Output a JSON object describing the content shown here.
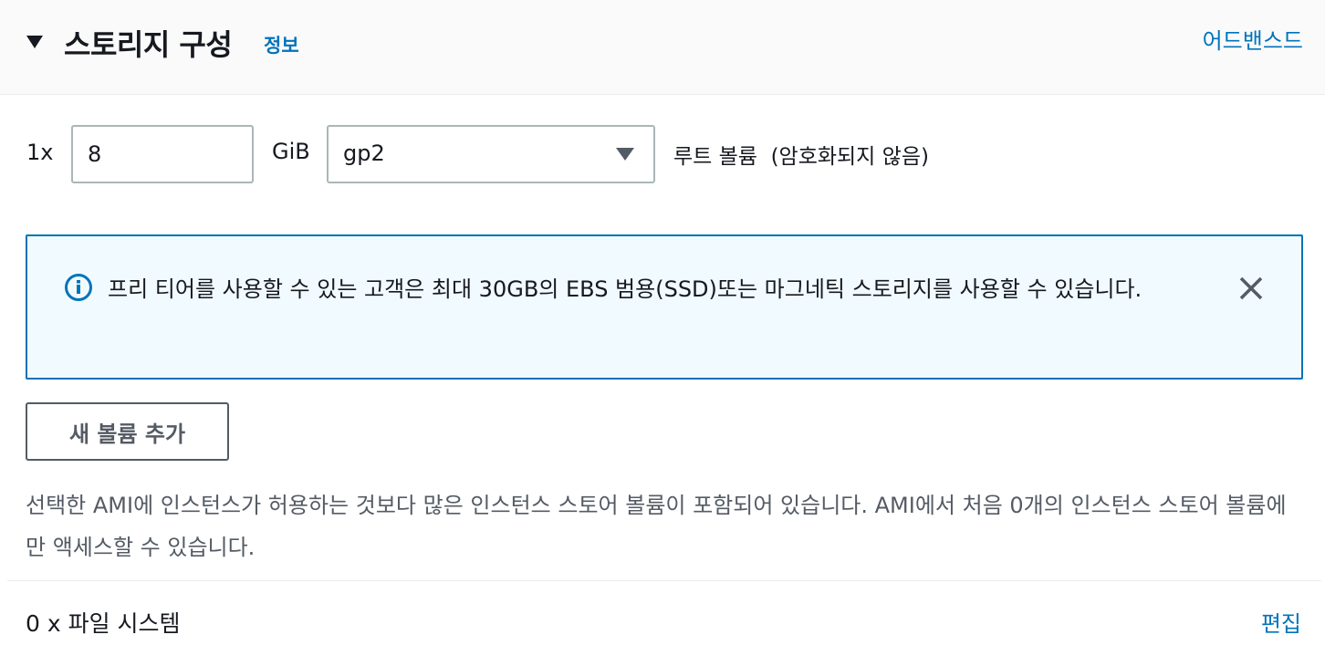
{
  "section": {
    "title": "스토리지 구성",
    "info_link": "정보",
    "advanced_link": "어드밴스드"
  },
  "volume": {
    "quantity_label": "1x",
    "size_value": "8",
    "unit": "GiB",
    "type_selected": "gp2",
    "description": "루트 볼륨  (암호화되지 않음)"
  },
  "alert": {
    "text": "프리 티어를 사용할 수 있는 고객은 최대 30GB의 EBS 범용(SSD)또는 마그네틱 스토리지를 사용할 수 있습니다."
  },
  "add_volume_button": "새 볼륨 추가",
  "instance_store_note": "선택한 AMI에 인스턴스가 허용하는 것보다 많은 인스턴스 스토어 볼륨이 포함되어 있습니다. AMI에서 처음 0개의 인스턴스 스토어 볼륨에만 액세스할 수 있습니다.",
  "file_systems": {
    "count_label": "0 x 파일 시스템",
    "edit_link": "편집"
  },
  "colors": {
    "link": "#0073bb",
    "alert_bg": "#f1faff",
    "alert_border": "#0073bb",
    "text": "#16191f",
    "muted": "#545b64"
  },
  "icons": {
    "collapse": "caret-down-icon",
    "select": "caret-down-icon",
    "alert": "info-icon",
    "close": "close-icon"
  }
}
